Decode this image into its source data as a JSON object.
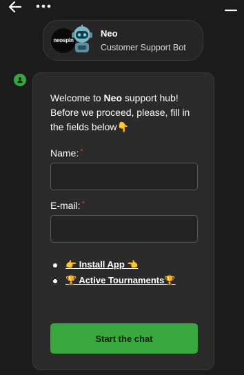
{
  "header": {
    "logo_text_a": "neo",
    "logo_text_b": "spin",
    "bot_name": "Neo",
    "bot_role": "Customer Support Bot"
  },
  "icons": {
    "back": "back-arrow-icon",
    "more": "more-dots-icon",
    "minimize": "minimize-icon",
    "avatar": "user-icon"
  },
  "message": {
    "welcome_pre": "Welcome to ",
    "welcome_bold": "Neo",
    "welcome_post": " support hub! Before we proceed, please, fill in the fields below👇",
    "name_label": "Name:",
    "email_label": "E-mail:",
    "required_mark": "*",
    "name_value": "",
    "email_value": "",
    "links": [
      {
        "label": "👉  Install App  👈"
      },
      {
        "label": "🏆 Active Tournaments🏆"
      }
    ],
    "start_label": "Start the chat"
  },
  "colors": {
    "accent": "#38a83e",
    "background": "#1c1c1c",
    "card": "#2b2b2b",
    "required": "#e23a3a"
  }
}
